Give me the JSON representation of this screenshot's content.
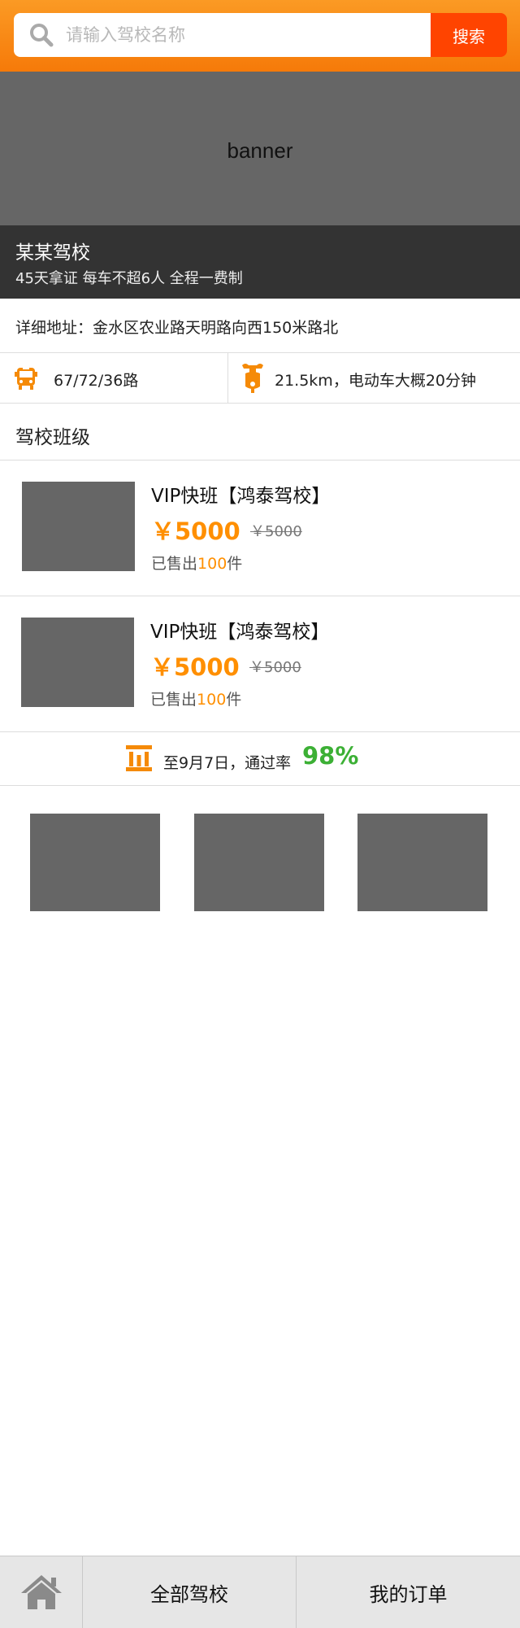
{
  "search": {
    "placeholder": "请输入驾校名称",
    "button_label": "搜索"
  },
  "banner": {
    "text": "banner"
  },
  "school": {
    "name": "某某驾校",
    "tagline": "45天拿证 每车不超6人 全程一费制",
    "address": "详细地址：金水区农业路天明路向西150米路北",
    "bus_routes": "67/72/36路",
    "distance": "21.5km，电动车大概20分钟"
  },
  "courses_section": {
    "title": "驾校班级"
  },
  "courses": [
    {
      "title": "VIP快班【鸿泰驾校】",
      "price": "￥5000",
      "old_price": "￥5000",
      "sold_prefix": "已售出",
      "sold_count": "100",
      "sold_suffix": "件"
    },
    {
      "title": "VIP快班【鸿泰驾校】",
      "price": "￥5000",
      "old_price": "￥5000",
      "sold_prefix": "已售出",
      "sold_count": "100",
      "sold_suffix": "件"
    }
  ],
  "stats": {
    "text": "至9月7日，通过率",
    "rate": "98%"
  },
  "footer": {
    "home_icon": "home-icon",
    "tabs": [
      {
        "label": "全部驾校"
      },
      {
        "label": "我的订单"
      }
    ]
  },
  "colors": {
    "header_orange": "#f67a09",
    "search_button": "#ff4400",
    "price": "#ff8f00",
    "pass_rate": "#3cb035",
    "placeholder_gray": "#666666"
  }
}
